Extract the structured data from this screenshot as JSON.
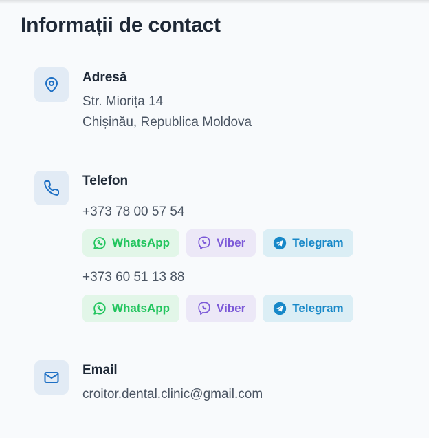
{
  "section": {
    "title": "Informații de contact"
  },
  "address": {
    "label": "Adresă",
    "line1": "Str. Miorița 14",
    "line2": "Chișinău, Republica Moldova"
  },
  "phone": {
    "label": "Telefon",
    "numbers": [
      {
        "number": "+373 78 00 57 54",
        "whatsapp": "WhatsApp",
        "viber": "Viber",
        "telegram": "Telegram"
      },
      {
        "number": "+373 60 51 13 88",
        "whatsapp": "WhatsApp",
        "viber": "Viber",
        "telegram": "Telegram"
      }
    ]
  },
  "email": {
    "label": "Email",
    "value": "croitor.dental.clinic@gmail.com"
  },
  "icons": {
    "address": "map-pin-icon",
    "phone": "phone-icon",
    "email": "mail-icon",
    "whatsapp": "whatsapp-icon",
    "viber": "viber-icon",
    "telegram": "telegram-icon"
  },
  "colors": {
    "accent": "#1d6fc4",
    "icon_bg": "#e2ebf5",
    "whatsapp": "#22c55e",
    "viber": "#7c59d8",
    "telegram": "#1788c8"
  }
}
